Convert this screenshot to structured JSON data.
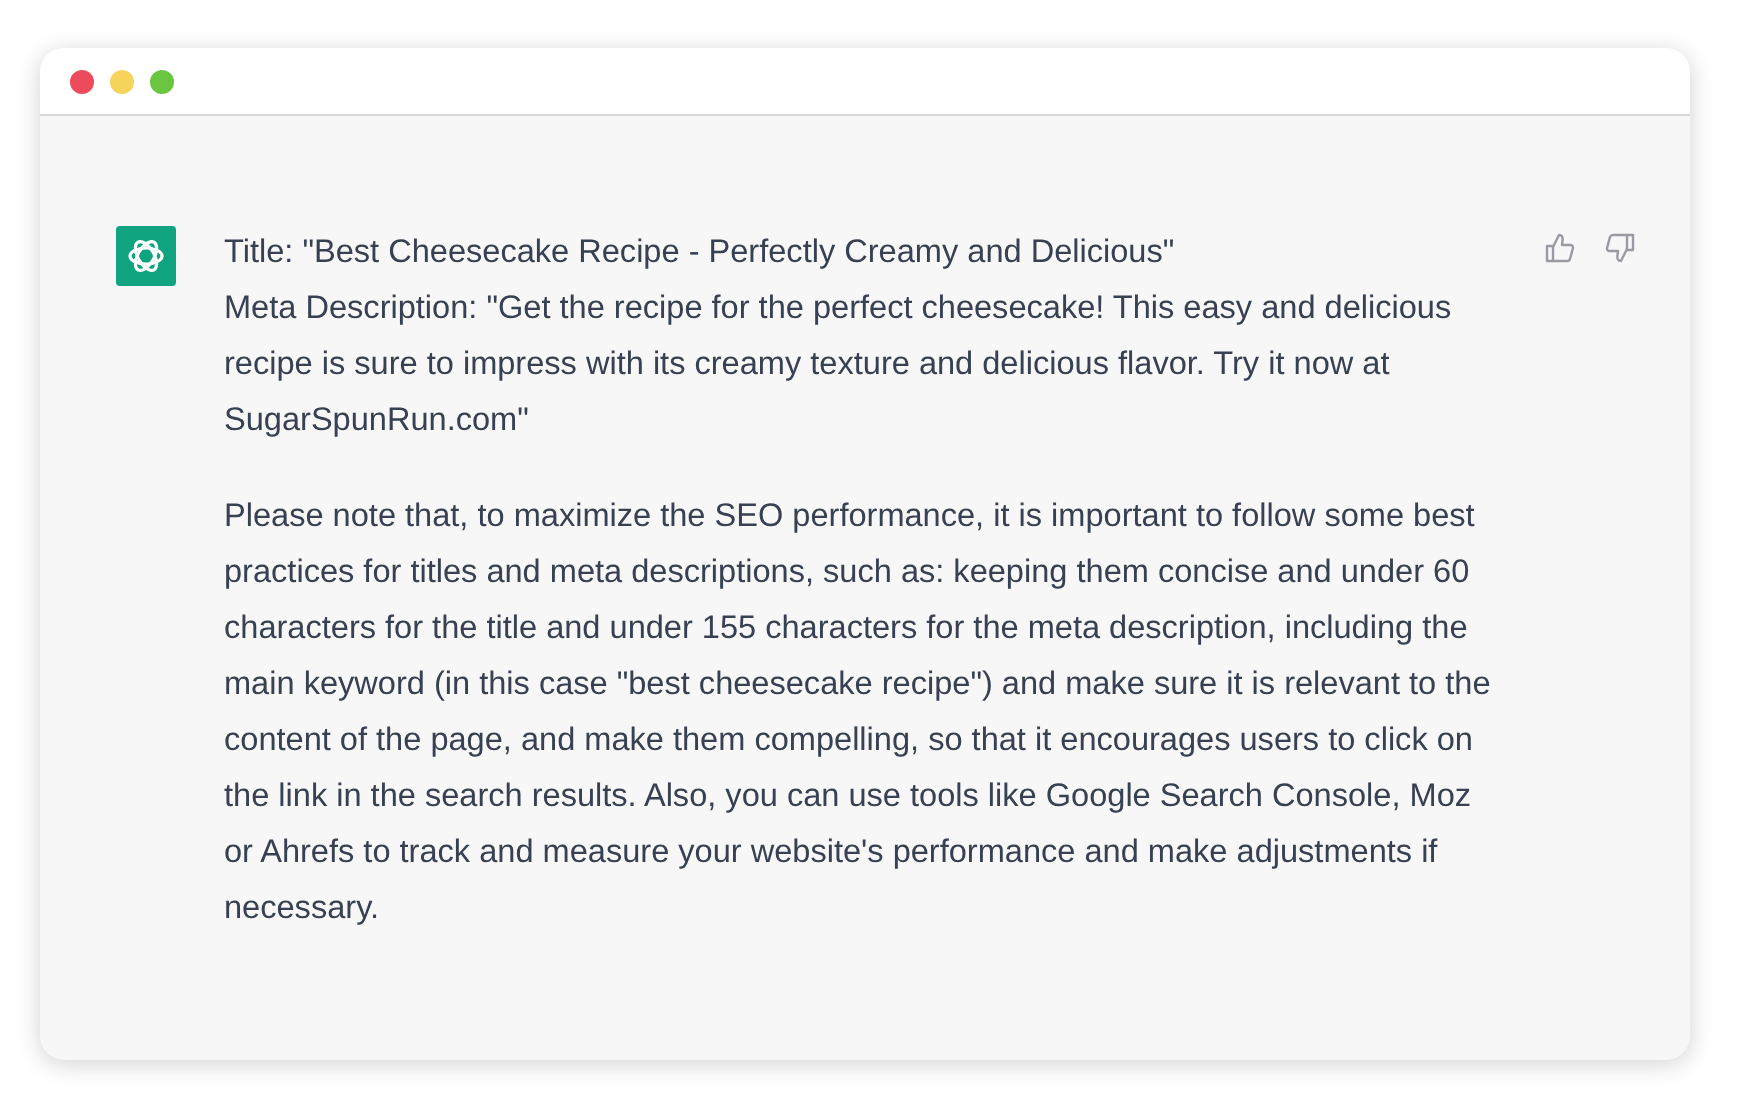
{
  "window": {
    "controls": [
      {
        "color": "#ed4a5b"
      },
      {
        "color": "#f6d45c"
      },
      {
        "color": "#6bc63f"
      }
    ]
  },
  "message": {
    "lines": [
      "Title: \"Best Cheesecake Recipe - Perfectly Creamy and Delicious\"",
      "Meta Description: \"Get the recipe for the perfect cheesecake! This easy and delicious recipe is sure to impress with its creamy texture and delicious flavor. Try it now at SugarSpunRun.com\""
    ],
    "paragraphs": [
      "Please note that, to maximize the SEO performance, it is important to follow some best practices for titles and meta descriptions, such as: keeping them concise and under 60 characters for the title and under 155 characters for the meta description, including the main keyword (in this case \"best cheesecake recipe\") and make sure it is relevant to the content of the page, and make them compelling, so that it encourages users to click on the link in the search results. Also, you can use tools like Google Search Console, Moz or Ahrefs to track and measure your website's performance and make adjustments if necessary."
    ]
  }
}
